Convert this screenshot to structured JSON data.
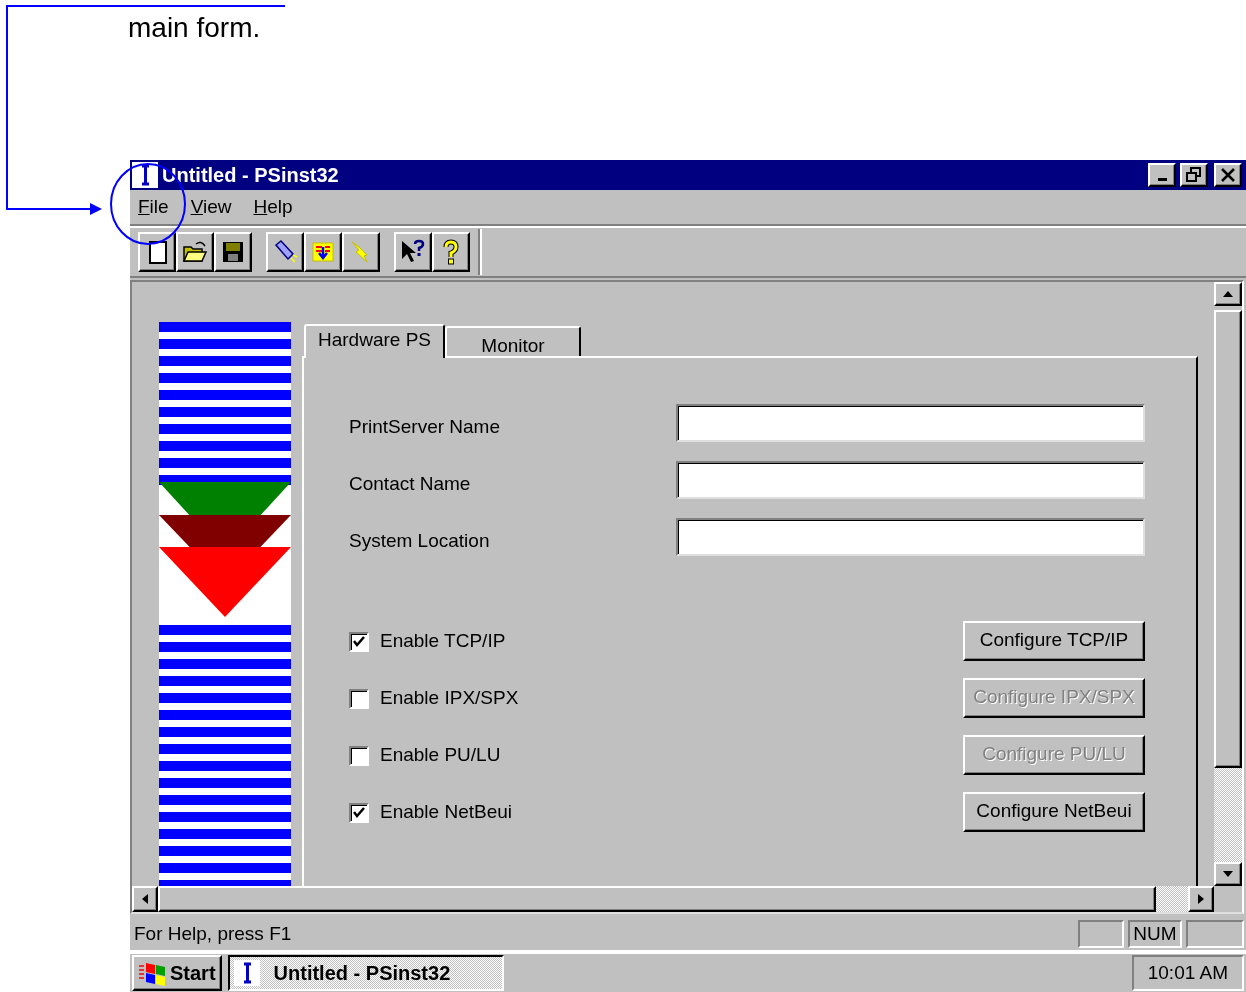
{
  "annotation": {
    "text": "main form."
  },
  "window": {
    "title": "Untitled - PSinst32"
  },
  "menu": [
    {
      "label": "File"
    },
    {
      "label": "View"
    },
    {
      "label": "Help"
    }
  ],
  "toolbar": [
    [
      {
        "kind": "page"
      },
      {
        "kind": "folder"
      },
      {
        "kind": "floppy"
      }
    ],
    [
      {
        "kind": "flashlight"
      },
      {
        "kind": "download"
      },
      {
        "kind": "lightning"
      }
    ],
    [
      {
        "kind": "pointer-question"
      },
      {
        "kind": "question"
      }
    ]
  ],
  "tabs": [
    {
      "label": "Hardware PS",
      "selected": true
    },
    {
      "label": "Monitor",
      "selected": false
    }
  ],
  "fields": [
    {
      "label": "PrintServer Name"
    },
    {
      "label": "Contact Name"
    },
    {
      "label": "System Location"
    }
  ],
  "options": [
    {
      "label": "Enable TCP/IP",
      "checked": true,
      "button": {
        "label": "Configure TCP/IP",
        "disabled": false
      }
    },
    {
      "label": "Enable IPX/SPX",
      "checked": false,
      "button": {
        "label": "Configure IPX/SPX",
        "disabled": true
      }
    },
    {
      "label": "Enable PU/LU",
      "checked": false,
      "button": {
        "label": "Configure PU/LU",
        "disabled": true
      }
    },
    {
      "label": "Enable NetBeui",
      "checked": true,
      "button": {
        "label": "Configure NetBeui",
        "disabled": false
      }
    }
  ],
  "status_bar": {
    "text": "For Help, press F1",
    "indicator": "NUM"
  },
  "taskbar": {
    "start": "Start",
    "task": "Untitled - PSinst32",
    "clock": "10:01 AM"
  }
}
